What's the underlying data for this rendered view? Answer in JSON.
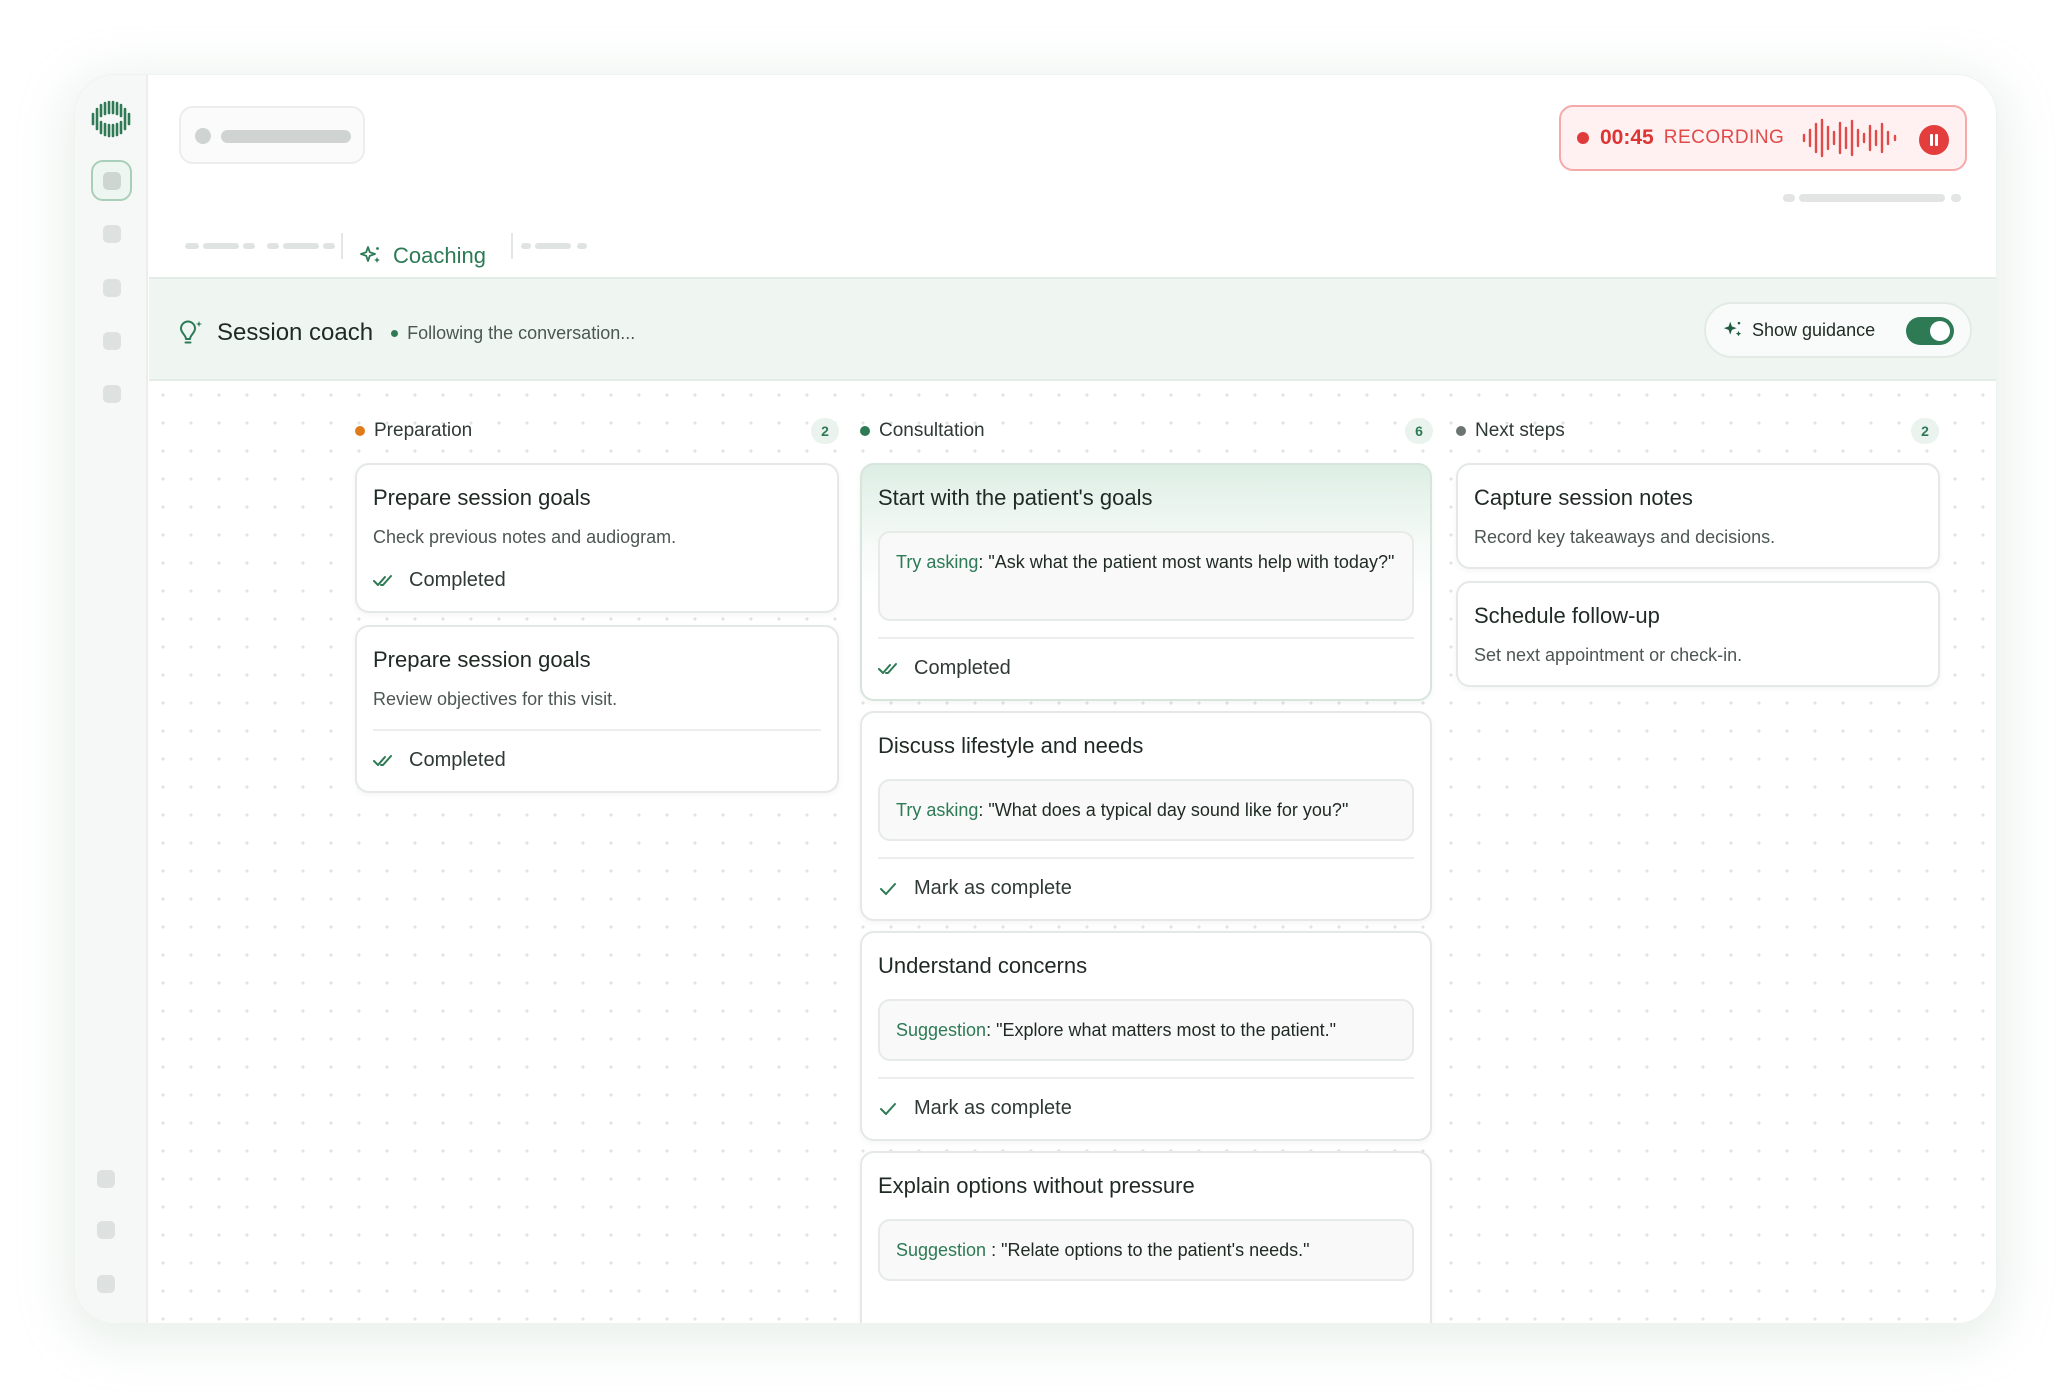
{
  "recording": {
    "time": "00:45",
    "label": "RECORDING",
    "accent": "#e03b3b"
  },
  "tabs": {
    "active_label": "Coaching",
    "active_icon": "sparkle-icon"
  },
  "coach": {
    "title": "Session coach",
    "status": "Following the conversation...",
    "guidance_label": "Show guidance",
    "guidance_on": true
  },
  "columns": [
    {
      "title": "Preparation",
      "count": "2",
      "dot_color": "#e07b1a",
      "cards": [
        {
          "title": "Prepare session goals",
          "desc": "Check previous notes and audiogram.",
          "status": "Completed"
        },
        {
          "title": "Prepare session goals",
          "desc": "Review objectives for this visit.",
          "status": "Completed"
        }
      ]
    },
    {
      "title": "Consultation",
      "count": "6",
      "dot_color": "#2d7a55",
      "cards": [
        {
          "title": "Start with the patient's goals",
          "prompt_key": "Try asking",
          "prompt_text": ": \"Ask what the patient most wants help with today?\"",
          "status": "Completed"
        },
        {
          "title": "Discuss lifestyle and needs",
          "prompt_key": "Try asking",
          "prompt_text": ": \"What does a typical day sound like for you?\"",
          "status": "Mark as complete"
        },
        {
          "title": "Understand concerns",
          "prompt_key": "Suggestion",
          "prompt_text": ": \"Explore what matters most to the patient.\"",
          "status": "Mark as complete"
        },
        {
          "title": "Explain options without pressure",
          "prompt_key": "Suggestion ",
          "prompt_text": ":  \"Relate options to the patient's needs.\""
        }
      ]
    },
    {
      "title": "Next steps",
      "count": "2",
      "dot_color": "#6b7570",
      "cards": [
        {
          "title": "Capture session notes",
          "desc": "Record key takeaways and decisions."
        },
        {
          "title": "Schedule follow-up",
          "desc": "Set next appointment or check-in."
        }
      ]
    }
  ],
  "colors": {
    "brand": "#2d7a55",
    "recording": "#e03b3b"
  }
}
